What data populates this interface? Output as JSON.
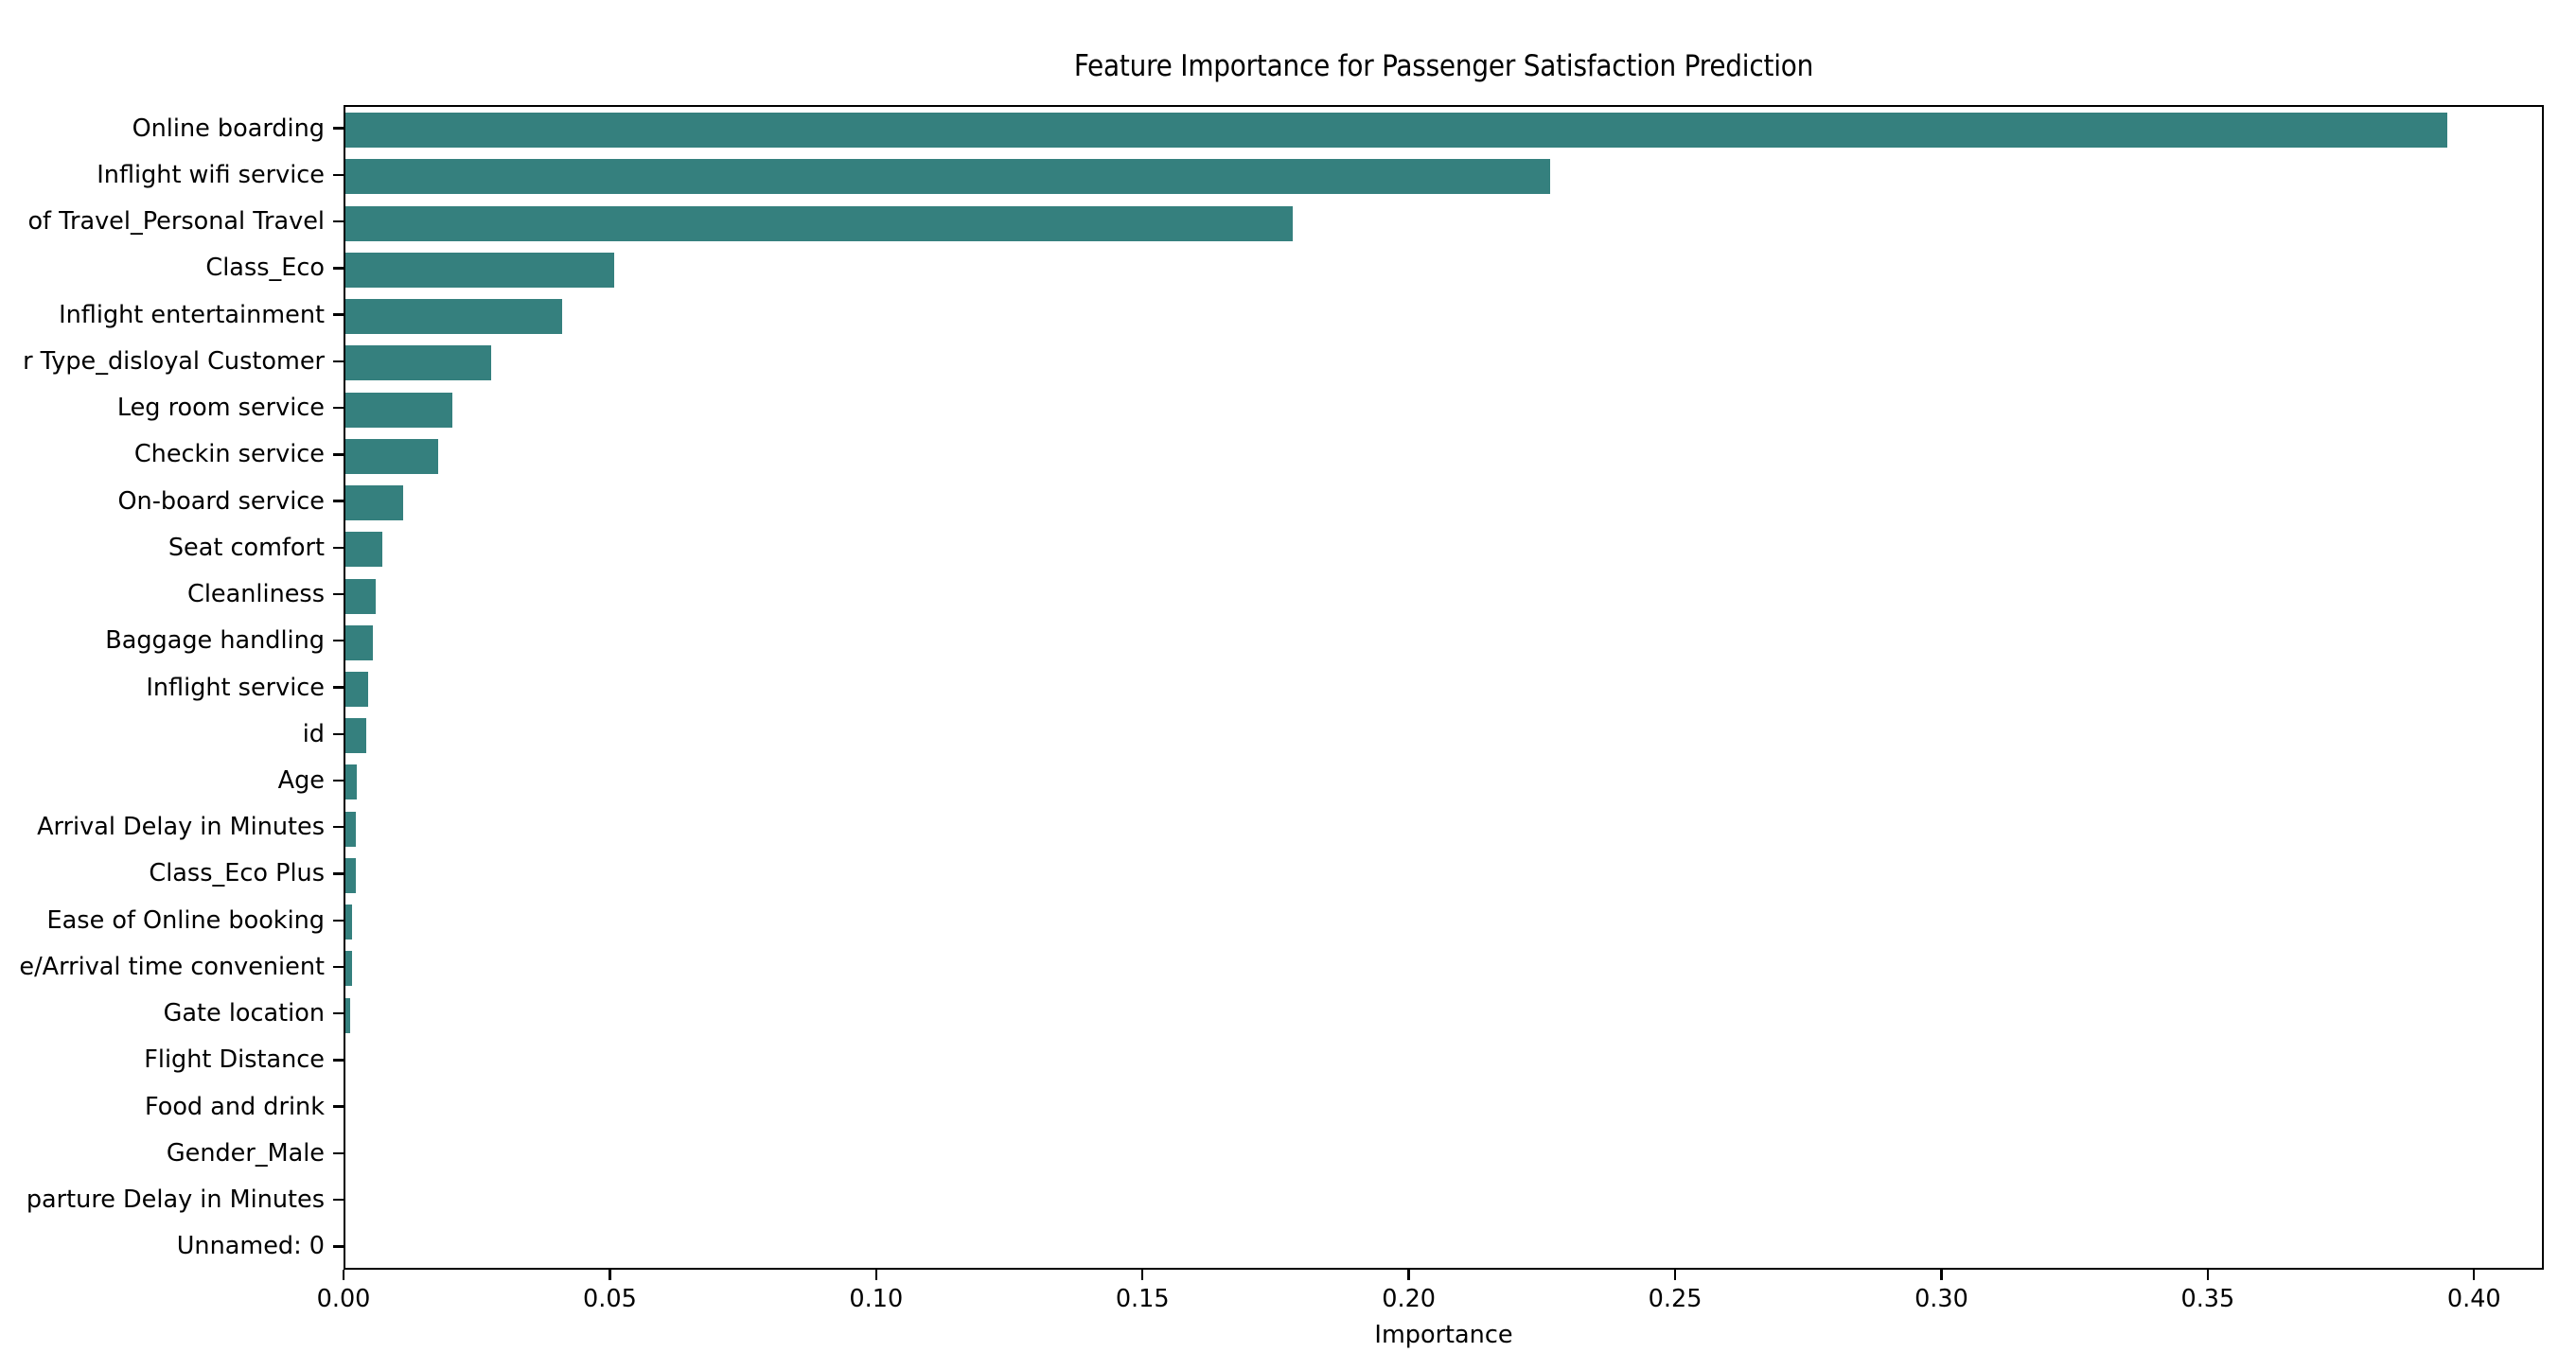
{
  "figure": {
    "background_color": "#ffffff",
    "bar_color": "#35807E",
    "axis_color": "#000000"
  },
  "chart_data": {
    "type": "bar",
    "orientation": "horizontal",
    "title": "Feature Importance for Passenger Satisfaction Prediction",
    "xlabel": "Importance",
    "ylabel": "",
    "xlim": [
      0.0,
      0.4131
    ],
    "xticks": [
      0.0,
      0.05,
      0.1,
      0.15,
      0.2,
      0.25,
      0.3,
      0.35,
      0.4
    ],
    "xtick_labels": [
      "0.00",
      "0.05",
      "0.10",
      "0.15",
      "0.20",
      "0.25",
      "0.30",
      "0.35",
      "0.40"
    ],
    "grid": false,
    "legend": null,
    "categories": [
      "Online boarding",
      "Inflight wifi service",
      "Type of Travel_Personal Travel",
      "Class_Eco",
      "Inflight entertainment",
      "Customer Type_disloyal Customer",
      "Leg room service",
      "Checkin service",
      "On-board service",
      "Seat comfort",
      "Cleanliness",
      "Baggage handling",
      "Inflight service",
      "id",
      "Age",
      "Arrival Delay in Minutes",
      "Class_Eco Plus",
      "Ease of Online booking",
      "Departure/Arrival time convenient",
      "Gate location",
      "Flight Distance",
      "Food and drink",
      "Gender_Male",
      "Departure Delay in Minutes",
      "Unnamed: 0"
    ],
    "tick_labels_visible": [
      "Online boarding",
      "Inflight wifi service",
      "of Travel_Personal Travel",
      "Class_Eco",
      "Inflight entertainment",
      "r Type_disloyal Customer",
      "Leg room service",
      "Checkin service",
      "On-board service",
      "Seat comfort",
      "Cleanliness",
      "Baggage handling",
      "Inflight service",
      "id",
      "Age",
      "Arrival Delay in Minutes",
      "Class_Eco Plus",
      "Ease of Online booking",
      "e/Arrival time convenient",
      "Gate location",
      "Flight Distance",
      "Food and drink",
      "Gender_Male",
      "parture Delay in Minutes",
      "Unnamed: 0"
    ],
    "values": [
      0.3946,
      0.2261,
      0.1778,
      0.0504,
      0.0406,
      0.0274,
      0.02,
      0.0175,
      0.0109,
      0.0069,
      0.0057,
      0.0052,
      0.0043,
      0.0039,
      0.0021,
      0.002,
      0.002,
      0.0012,
      0.0012,
      0.0008,
      0.0,
      0.0,
      0.0,
      0.0,
      0.0
    ]
  }
}
